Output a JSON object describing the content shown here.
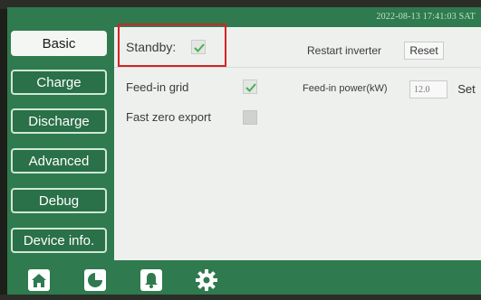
{
  "status": {
    "datetime": "2022-08-13 17:41:03 SAT"
  },
  "sidebar": {
    "items": [
      {
        "label": "Basic",
        "active": true
      },
      {
        "label": "Charge",
        "active": false
      },
      {
        "label": "Discharge",
        "active": false
      },
      {
        "label": "Advanced",
        "active": false
      },
      {
        "label": "Debug",
        "active": false
      },
      {
        "label": "Device info.",
        "active": false
      }
    ]
  },
  "basic": {
    "standby_label": "Standby:",
    "standby_checked": true,
    "restart_label": "Restart inverter",
    "reset_label": "Reset",
    "feed_in_label": "Feed-in grid",
    "feed_in_checked": true,
    "feed_in_power_label": "Feed-in power(kW)",
    "feed_in_power_value": "12.0",
    "set_label": "Set",
    "fast_zero_label": "Fast zero export",
    "fast_zero_checked": false
  },
  "bottom_nav": {
    "icons": [
      "home-icon",
      "pie-chart-icon",
      "bell-icon",
      "gear-icon"
    ]
  },
  "colors": {
    "theme_green": "#2f7a4e",
    "check_green": "#4caf50",
    "highlight_red": "#d32424"
  }
}
